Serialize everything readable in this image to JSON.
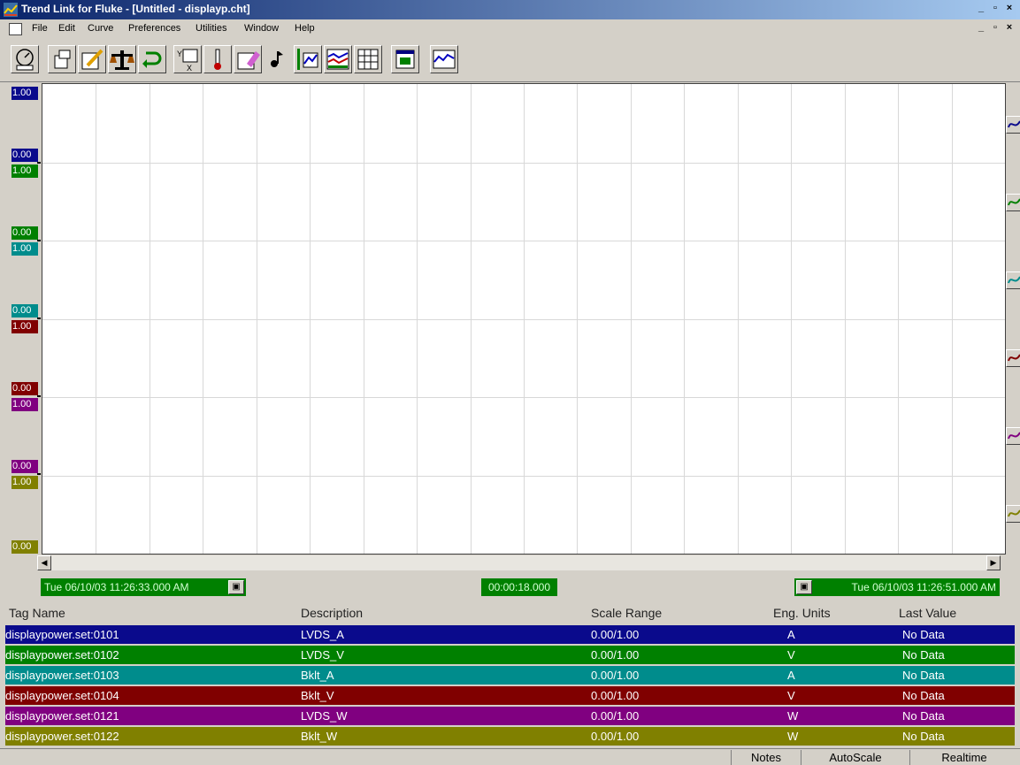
{
  "window": {
    "title": "Trend Link for Fluke - [Untitled - displayp.cht]"
  },
  "menu": [
    "File",
    "Edit",
    "Curve",
    "Preferences",
    "Utilities",
    "Window",
    "Help"
  ],
  "toolbar": [
    "open-chart-icon",
    "new-tag-icon",
    "edit-pen-icon",
    "scale-icon",
    "undo-icon",
    "xy-plot-icon",
    "thermometer-icon",
    "eraser-icon",
    "music-note-icon",
    "bar-chart-icon",
    "multi-curve-icon",
    "grid-icon",
    "window-icon",
    "trend-icon"
  ],
  "colors": {
    "c1": "#0a0a8c",
    "c2": "#008000",
    "c3": "#008c8c",
    "c4": "#800000",
    "c5": "#800080",
    "c6": "#808000",
    "grid": "#d8d8d8"
  },
  "scales": [
    {
      "max": "1.00",
      "min": "0.00"
    },
    {
      "max": "1.00",
      "min": "0.00"
    },
    {
      "max": "1.00",
      "min": "0.00"
    },
    {
      "max": "1.00",
      "min": "0.00"
    },
    {
      "max": "1.00",
      "min": "0.00"
    },
    {
      "max": "1.00",
      "min": "0.00"
    }
  ],
  "time": {
    "start": "Tue 06/10/03 11:26:33.000 AM",
    "span": "00:00:18.000",
    "end": "Tue 06/10/03 11:26:51.000 AM"
  },
  "columns": {
    "tag": "Tag Name",
    "desc": "Description",
    "range": "Scale Range",
    "units": "Eng. Units",
    "last": "Last Value"
  },
  "rows": [
    {
      "tag": "displaypower.set:0101",
      "desc": "LVDS_A",
      "range": "0.00/1.00",
      "units": "A",
      "last": "No Data"
    },
    {
      "tag": "displaypower.set:0102",
      "desc": "LVDS_V",
      "range": "0.00/1.00",
      "units": "V",
      "last": "No Data"
    },
    {
      "tag": "displaypower.set:0103",
      "desc": "Bklt_A",
      "range": "0.00/1.00",
      "units": "A",
      "last": "No Data"
    },
    {
      "tag": "displaypower.set:0104",
      "desc": "Bklt_V",
      "range": "0.00/1.00",
      "units": "V",
      "last": "No Data"
    },
    {
      "tag": "displaypower.set:0121",
      "desc": "LVDS_W",
      "range": "0.00/1.00",
      "units": "W",
      "last": "No Data"
    },
    {
      "tag": "displaypower.set:0122",
      "desc": "Bklt_W",
      "range": "0.00/1.00",
      "units": "W",
      "last": "No Data"
    }
  ],
  "status": {
    "notes": "Notes",
    "autoscale": "AutoScale",
    "realtime": "Realtime"
  }
}
